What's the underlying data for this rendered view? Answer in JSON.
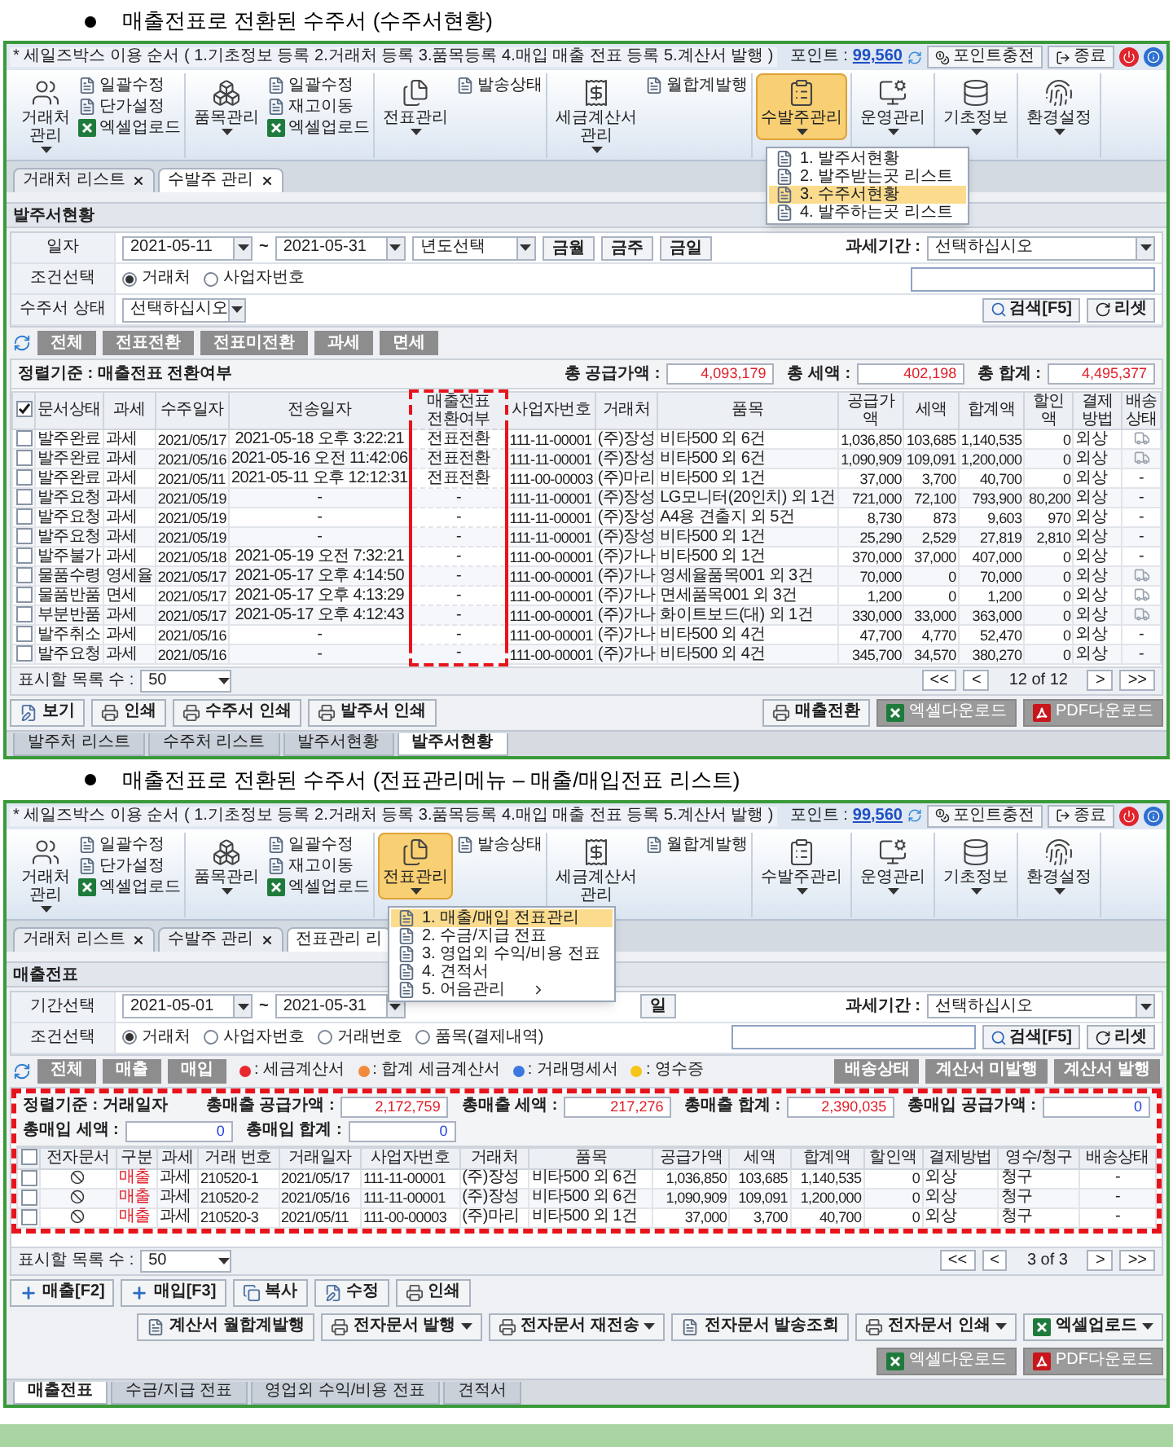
{
  "sections": [
    {
      "heading": "매출전표로 전환된 수주서 (수주서현황)",
      "screen": {
        "title": "* 세일즈박스 이용 순서 ( 1.기초정보 등록  2.거래처 등록  3.품목등록  4.매입 매출 전표 등록  5.계산서 발행 )",
        "points_label": "포인트 :",
        "points": "99,560",
        "charge": "포인트충전",
        "exit": "종료",
        "ribbon": [
          {
            "label": "거래처 관리",
            "selected": false,
            "subs": [
              {
                "kind": "doc",
                "label": "일괄수정"
              },
              {
                "kind": "doc",
                "label": "단가설정"
              },
              {
                "kind": "excel",
                "label": "엑셀업로드"
              }
            ]
          },
          {
            "label": "품목관리",
            "selected": false,
            "subs": [
              {
                "kind": "doc",
                "label": "일괄수정"
              },
              {
                "kind": "doc",
                "label": "재고이동"
              },
              {
                "kind": "excel",
                "label": "엑셀업로드"
              }
            ]
          },
          {
            "label": "전표관리",
            "selected": false,
            "subs": [
              {
                "kind": "doc",
                "label": "발송상태"
              }
            ]
          },
          {
            "label": "세금계산서 관리",
            "selected": false,
            "subs": [
              {
                "kind": "doc",
                "label": "월합계발행"
              }
            ]
          },
          {
            "label": "수발주관리",
            "selected": true,
            "menu": [
              {
                "label": "1. 발주서현황",
                "selected": false,
                "submenu": false
              },
              {
                "label": "2. 발주받는곳 리스트",
                "selected": false,
                "submenu": false
              },
              {
                "label": "3. 수주서현황",
                "selected": true,
                "submenu": false
              },
              {
                "label": "4. 발주하는곳 리스트",
                "selected": false,
                "submenu": false
              }
            ]
          },
          {
            "label": "운영관리",
            "selected": false
          },
          {
            "label": "기초정보",
            "selected": false
          },
          {
            "label": "환경설정",
            "selected": false
          }
        ],
        "tabs": [
          {
            "label": "거래처 리스트",
            "selected": false,
            "closable": true
          },
          {
            "label": "수발주 관리",
            "selected": true,
            "closable": true
          }
        ],
        "section_title": "발주서현황",
        "filters": [
          {
            "label": "일자",
            "left": [
              {
                "kind": "date",
                "value": "2021-05-11"
              },
              {
                "kind": "text",
                "text": "~"
              },
              {
                "kind": "date",
                "value": "2021-05-31"
              },
              {
                "kind": "select",
                "value": "년도선택"
              },
              {
                "kind": "button",
                "label": "금월"
              },
              {
                "kind": "button",
                "label": "금주"
              },
              {
                "kind": "button",
                "label": "금일"
              }
            ],
            "right": [
              {
                "kind": "text",
                "text": "과세기간 :"
              },
              {
                "kind": "select",
                "value": "선택하십시오"
              }
            ]
          },
          {
            "label": "조건선택",
            "left": [
              {
                "kind": "radio",
                "label": "거래처",
                "selected": true
              },
              {
                "kind": "radio",
                "label": "사업자번호",
                "selected": false
              }
            ],
            "right": [
              {
                "kind": "input"
              }
            ]
          },
          {
            "label": "수주서 상태",
            "left": [
              {
                "kind": "select",
                "value": "선택하십시오"
              }
            ],
            "right": [
              {
                "kind": "search",
                "label": "검색[F5]"
              },
              {
                "kind": "reset",
                "label": "리셋"
              }
            ]
          }
        ],
        "actions": {
          "left": [
            "전체",
            "전표전환",
            "전표미전환",
            "과세",
            "면세"
          ]
        },
        "sort_label": "정렬기준 : 매출전표 전환여부",
        "totals": [
          {
            "label": "총 공급가액 :",
            "value": "4,093,179",
            "color": "#e0202a"
          },
          {
            "label": "총 세액 :",
            "value": "402,198",
            "color": "#e0202a"
          },
          {
            "label": "총 합계 :",
            "value": "4,495,377",
            "color": "#e0202a"
          }
        ],
        "table": {
          "framed": false,
          "header_checked": true,
          "columns": [
            {
              "label": "문서상태",
              "kind": "text",
              "highlighted": false
            },
            {
              "label": "과세",
              "kind": "text",
              "highlighted": false
            },
            {
              "label": "수주일자",
              "kind": "num",
              "highlighted": false
            },
            {
              "label": "전송일자",
              "kind": "center",
              "highlighted": false
            },
            {
              "label": "매출전표 전환여부",
              "kind": "center",
              "highlighted": true
            },
            {
              "label": "사업자번호",
              "kind": "num",
              "highlighted": false
            },
            {
              "label": "거래처",
              "kind": "text",
              "highlighted": false
            },
            {
              "label": "품목",
              "kind": "text",
              "highlighted": false
            },
            {
              "label": "공급가액",
              "kind": "amount",
              "highlighted": false
            },
            {
              "label": "세액",
              "kind": "amount",
              "highlighted": false
            },
            {
              "label": "합계액",
              "kind": "amount",
              "highlighted": false
            },
            {
              "label": "할인액",
              "kind": "amount",
              "highlighted": false
            },
            {
              "label": "결제방법",
              "kind": "text",
              "highlighted": false
            },
            {
              "label": "배송상태",
              "kind": "delivery",
              "highlighted": false
            }
          ],
          "rows": [
            {
              "checked": false,
              "cells": [
                "발주완료",
                "과세",
                "2021/05/17",
                "2021-05-18 오후 3:22:21",
                "전표전환",
                "111-11-00001",
                "(주)장성",
                "비타500 외 6건",
                "1,036,850",
                "103,685",
                "1,140,535",
                "0",
                "외상",
                {
                  "kind": "icon"
                }
              ]
            },
            {
              "checked": false,
              "cells": [
                "발주완료",
                "과세",
                "2021/05/16",
                "2021-05-16 오전 11:42:06",
                "전표전환",
                "111-11-00001",
                "(주)장성",
                "비타500 외 6건",
                "1,090,909",
                "109,091",
                "1,200,000",
                "0",
                "외상",
                {
                  "kind": "icon"
                }
              ]
            },
            {
              "checked": false,
              "cells": [
                "발주완료",
                "과세",
                "2021/05/11",
                "2021-05-11 오후 12:12:31",
                "전표전환",
                "111-00-00003",
                "(주)마리",
                "비타500 외 1건",
                "37,000",
                "3,700",
                "40,700",
                "0",
                "외상",
                "-"
              ]
            },
            {
              "checked": false,
              "cells": [
                "발주요청",
                "과세",
                "2021/05/19",
                "-",
                "-",
                "111-11-00001",
                "(주)장성",
                "LG모니터(20인치) 외 1건",
                "721,000",
                "72,100",
                "793,900",
                "80,200",
                "외상",
                "-"
              ]
            },
            {
              "checked": false,
              "cells": [
                "발주요청",
                "과세",
                "2021/05/19",
                "-",
                "-",
                "111-11-00001",
                "(주)장성",
                "A4용 견출지 외 5건",
                "8,730",
                "873",
                "9,603",
                "970",
                "외상",
                "-"
              ]
            },
            {
              "checked": false,
              "cells": [
                "발주요청",
                "과세",
                "2021/05/19",
                "-",
                "-",
                "111-11-00001",
                "(주)장성",
                "비타500 외 1건",
                "25,290",
                "2,529",
                "27,819",
                "2,810",
                "외상",
                "-"
              ]
            },
            {
              "checked": false,
              "cells": [
                "발주불가",
                "과세",
                "2021/05/18",
                "2021-05-19 오전 7:32:21",
                "-",
                "111-00-00001",
                "(주)가나",
                "비타500 외 1건",
                "370,000",
                "37,000",
                "407,000",
                "0",
                "외상",
                "-"
              ]
            },
            {
              "checked": false,
              "cells": [
                "물품수령",
                "영세율",
                "2021/05/17",
                "2021-05-17 오후 4:14:50",
                "-",
                "111-00-00001",
                "(주)가나",
                "영세율품목001 외 3건",
                "70,000",
                "0",
                "70,000",
                "0",
                "외상",
                {
                  "kind": "icon"
                }
              ]
            },
            {
              "checked": false,
              "cells": [
                "물품반품",
                "면세",
                "2021/05/17",
                "2021-05-17 오후 4:13:29",
                "-",
                "111-00-00001",
                "(주)가나",
                "면세품목001 외 3건",
                "1,200",
                "0",
                "1,200",
                "0",
                "외상",
                {
                  "kind": "icon"
                }
              ]
            },
            {
              "checked": false,
              "cells": [
                "부분반품",
                "과세",
                "2021/05/17",
                "2021-05-17 오후 4:12:43",
                "-",
                "111-00-00001",
                "(주)가나",
                "화이트보드(대) 외 1건",
                "330,000",
                "33,000",
                "363,000",
                "0",
                "외상",
                {
                  "kind": "icon"
                }
              ]
            },
            {
              "checked": false,
              "cells": [
                "발주취소",
                "과세",
                "2021/05/16",
                "-",
                "-",
                "111-00-00001",
                "(주)가나",
                "비타500 외 4건",
                "47,700",
                "4,770",
                "52,470",
                "0",
                "외상",
                "-"
              ]
            },
            {
              "checked": false,
              "cells": [
                "발주요청",
                "과세",
                "2021/05/16",
                "-",
                "-",
                "111-00-00001",
                "(주)가나",
                "비타500 외 4건",
                "345,700",
                "34,570",
                "380,270",
                "0",
                "외상",
                "-"
              ]
            }
          ]
        },
        "page_size_label": "표시할 목록 수 :",
        "page_size": "50",
        "pager": {
          "first": "<<",
          "prev": "<",
          "status": "12 of 12",
          "next": ">",
          "last": ">>"
        },
        "buttons_left": [
          {
            "kind": "view",
            "label": "보기",
            "dropdown": false
          },
          {
            "kind": "print",
            "label": "인쇄",
            "dropdown": false
          },
          {
            "kind": "print",
            "label": "수주서 인쇄",
            "dropdown": false
          },
          {
            "kind": "print",
            "label": "발주서 인쇄",
            "dropdown": false
          }
        ],
        "buttons_right": [
          {
            "kind": "print",
            "label": "매출전환",
            "dropdown": false
          },
          {
            "kind": "excel_download",
            "label": "엑셀다운로드",
            "dropdown": false
          },
          {
            "kind": "pdf_download",
            "label": "PDF다운로드",
            "dropdown": false
          }
        ],
        "bottom_tabs": [
          {
            "label": "발주처 리스트",
            "selected": false
          },
          {
            "label": "수주처 리스트",
            "selected": false
          },
          {
            "label": "발주서현황",
            "selected": false
          },
          {
            "label": "발주서현황",
            "selected": true
          }
        ]
      }
    },
    {
      "heading": "매출전표로 전환된 수주서 (전표관리메뉴 – 매출/매입전표 리스트)",
      "screen": {
        "title": "* 세일즈박스 이용 순서 ( 1.기초정보 등록  2.거래처 등록  3.품목등록  4.매입 매출 전표 등록  5.계산서 발행 )",
        "points_label": "포인트 :",
        "points": "99,560",
        "charge": "포인트충전",
        "exit": "종료",
        "ribbon": [
          {
            "label": "거래처 관리",
            "selected": false,
            "subs": [
              {
                "kind": "doc",
                "label": "일괄수정"
              },
              {
                "kind": "doc",
                "label": "단가설정"
              },
              {
                "kind": "excel",
                "label": "엑셀업로드"
              }
            ]
          },
          {
            "label": "품목관리",
            "selected": false,
            "subs": [
              {
                "kind": "doc",
                "label": "일괄수정"
              },
              {
                "kind": "doc",
                "label": "재고이동"
              },
              {
                "kind": "excel",
                "label": "엑셀업로드"
              }
            ]
          },
          {
            "label": "전표관리",
            "selected": true,
            "subs": [
              {
                "kind": "doc",
                "label": "발송상태"
              }
            ],
            "menu": [
              {
                "label": "1. 매출/매입 전표관리",
                "selected": true,
                "submenu": false
              },
              {
                "label": "2. 수금/지급 전표",
                "selected": false,
                "submenu": false
              },
              {
                "label": "3. 영업외 수익/비용 전표",
                "selected": false,
                "submenu": false
              },
              {
                "label": "4. 견적서",
                "selected": false,
                "submenu": false
              },
              {
                "label": "5. 어음관리",
                "selected": false,
                "submenu": true
              }
            ]
          },
          {
            "label": "세금계산서 관리",
            "selected": false,
            "subs": [
              {
                "kind": "doc",
                "label": "월합계발행"
              }
            ]
          },
          {
            "label": "수발주관리",
            "selected": false
          },
          {
            "label": "운영관리",
            "selected": false
          },
          {
            "label": "기초정보",
            "selected": false
          },
          {
            "label": "환경설정",
            "selected": false
          }
        ],
        "tabs": [
          {
            "label": "거래처 리스트",
            "selected": false,
            "closable": true
          },
          {
            "label": "수발주 관리",
            "selected": false,
            "closable": true
          },
          {
            "label": "전표관리 리",
            "selected": true,
            "closable": false
          }
        ],
        "section_title": "매출전표",
        "filters": [
          {
            "label": "기간선택",
            "left": [
              {
                "kind": "date",
                "value": "2021-05-01"
              },
              {
                "kind": "text",
                "text": "~"
              },
              {
                "kind": "date",
                "value": "2021-05-31"
              }
            ],
            "after_menu": [
              {
                "kind": "button",
                "label": "일"
              }
            ],
            "right": [
              {
                "kind": "text",
                "text": "과세기간 :"
              },
              {
                "kind": "select",
                "value": "선택하십시오"
              }
            ]
          },
          {
            "label": "조건선택",
            "left": [
              {
                "kind": "radio",
                "label": "거래처",
                "selected": true
              },
              {
                "kind": "radio",
                "label": "사업자번호",
                "selected": false
              },
              {
                "kind": "radio",
                "label": "거래번호",
                "selected": false
              },
              {
                "kind": "radio",
                "label": "품목(결제내역)",
                "selected": false
              }
            ],
            "right": [
              {
                "kind": "input"
              },
              {
                "kind": "search",
                "label": "검색[F5]"
              },
              {
                "kind": "reset",
                "label": "리셋"
              }
            ]
          }
        ],
        "actions": {
          "left": [
            "전체",
            "매출",
            "매입"
          ],
          "legend": [
            {
              "label": ": 세금계산서",
              "color": "#e8282e"
            },
            {
              "label": ": 합계 세금계산서",
              "color": "#f08a3c"
            },
            {
              "label": ": 거래명세서",
              "color": "#3c78e0"
            },
            {
              "label": ": 영수증",
              "color": "#f5c518"
            }
          ],
          "right": [
            "배송상태",
            "계산서 미발행",
            "계산서 발행"
          ]
        },
        "sort_label": "정렬기준 : 거래일자",
        "totals": [
          {
            "label": "총매출 공급가액 :",
            "value": "2,172,759",
            "color": "#e0202a"
          },
          {
            "label": "총매출 세액 :",
            "value": "217,276",
            "color": "#e0202a"
          },
          {
            "label": "총매출 합계 :",
            "value": "2,390,035",
            "color": "#e0202a"
          },
          {
            "label": "총매입 공급가액 :",
            "value": "0",
            "color": "#2040e0"
          },
          {
            "label": "총매입 세액 :",
            "value": "0",
            "color": "#2040e0"
          },
          {
            "label": "총매입 합계 :",
            "value": "0",
            "color": "#2040e0"
          }
        ],
        "table": {
          "framed": true,
          "header_checked": false,
          "columns": [
            {
              "label": "전자문서",
              "kind": "edoc",
              "highlighted": false
            },
            {
              "label": "구분",
              "kind": "type",
              "highlighted": false
            },
            {
              "label": "과세",
              "kind": "text",
              "highlighted": false
            },
            {
              "label": "거래 번호",
              "kind": "num",
              "highlighted": false
            },
            {
              "label": "거래일자",
              "kind": "num",
              "highlighted": false
            },
            {
              "label": "사업자번호",
              "kind": "num",
              "highlighted": false
            },
            {
              "label": "거래처",
              "kind": "text",
              "highlighted": false
            },
            {
              "label": "품목",
              "kind": "text",
              "highlighted": false
            },
            {
              "label": "공급가액",
              "kind": "amount",
              "highlighted": false
            },
            {
              "label": "세액",
              "kind": "amount",
              "highlighted": false
            },
            {
              "label": "합계액",
              "kind": "amount",
              "highlighted": false
            },
            {
              "label": "할인액",
              "kind": "amount",
              "highlighted": false
            },
            {
              "label": "결제방법",
              "kind": "text",
              "highlighted": false
            },
            {
              "label": "영수/청구",
              "kind": "text",
              "highlighted": false
            },
            {
              "label": "배송상태",
              "kind": "center",
              "highlighted": false
            }
          ],
          "rows": [
            {
              "checked": false,
              "cells": [
                {
                  "kind": "icon"
                },
                "매출",
                "과세",
                "210520-1",
                "2021/05/17",
                "111-11-00001",
                "(주)장성",
                "비타500 외 6건",
                "1,036,850",
                "103,685",
                "1,140,535",
                "0",
                "외상",
                "청구",
                "-"
              ]
            },
            {
              "checked": false,
              "cells": [
                {
                  "kind": "icon"
                },
                "매출",
                "과세",
                "210520-2",
                "2021/05/16",
                "111-11-00001",
                "(주)장성",
                "비타500 외 6건",
                "1,090,909",
                "109,091",
                "1,200,000",
                "0",
                "외상",
                "청구",
                "-"
              ]
            },
            {
              "checked": false,
              "cells": [
                {
                  "kind": "icon"
                },
                "매출",
                "과세",
                "210520-3",
                "2021/05/11",
                "111-00-00003",
                "(주)마리",
                "비타500 외 1건",
                "37,000",
                "3,700",
                "40,700",
                "0",
                "외상",
                "청구",
                "-"
              ]
            }
          ]
        },
        "page_size_label": "표시할 목록 수 :",
        "page_size": "50",
        "pager": {
          "first": "<<",
          "prev": "<",
          "status": "3 of 3",
          "next": ">",
          "last": ">>"
        },
        "buttons_left": [
          {
            "kind": "plus",
            "label": "매출[F2]",
            "dropdown": false
          },
          {
            "kind": "plus",
            "label": "매입[F3]",
            "dropdown": false
          },
          {
            "kind": "copy",
            "label": "복사",
            "dropdown": false
          },
          {
            "kind": "view",
            "label": "수정",
            "dropdown": false
          },
          {
            "kind": "print",
            "label": "인쇄",
            "dropdown": false
          }
        ],
        "buttons_right": [
          {
            "kind": "doc",
            "label": "계산서 월합계발행",
            "dropdown": false
          },
          {
            "kind": "print",
            "label": "전자문서 발행",
            "dropdown": true
          },
          {
            "kind": "print",
            "label": "전자문서 재전송",
            "dropdown": true
          },
          {
            "kind": "doc",
            "label": "전자문서 발송조회",
            "dropdown": false
          },
          {
            "kind": "print",
            "label": "전자문서 인쇄",
            "dropdown": true
          },
          {
            "kind": "excel_upload",
            "label": "엑셀업로드",
            "dropdown": true
          },
          {
            "kind": "excel_download",
            "label": "엑셀다운로드",
            "dropdown": false
          },
          {
            "kind": "pdf_download",
            "label": "PDF다운로드",
            "dropdown": false
          }
        ],
        "bottom_tabs": [
          {
            "label": "매출전표",
            "selected": true
          },
          {
            "label": "수금/지급 전표",
            "selected": false
          },
          {
            "label": "영업외 수익/비용 전표",
            "selected": false
          },
          {
            "label": "견적서",
            "selected": false
          }
        ]
      }
    }
  ]
}
